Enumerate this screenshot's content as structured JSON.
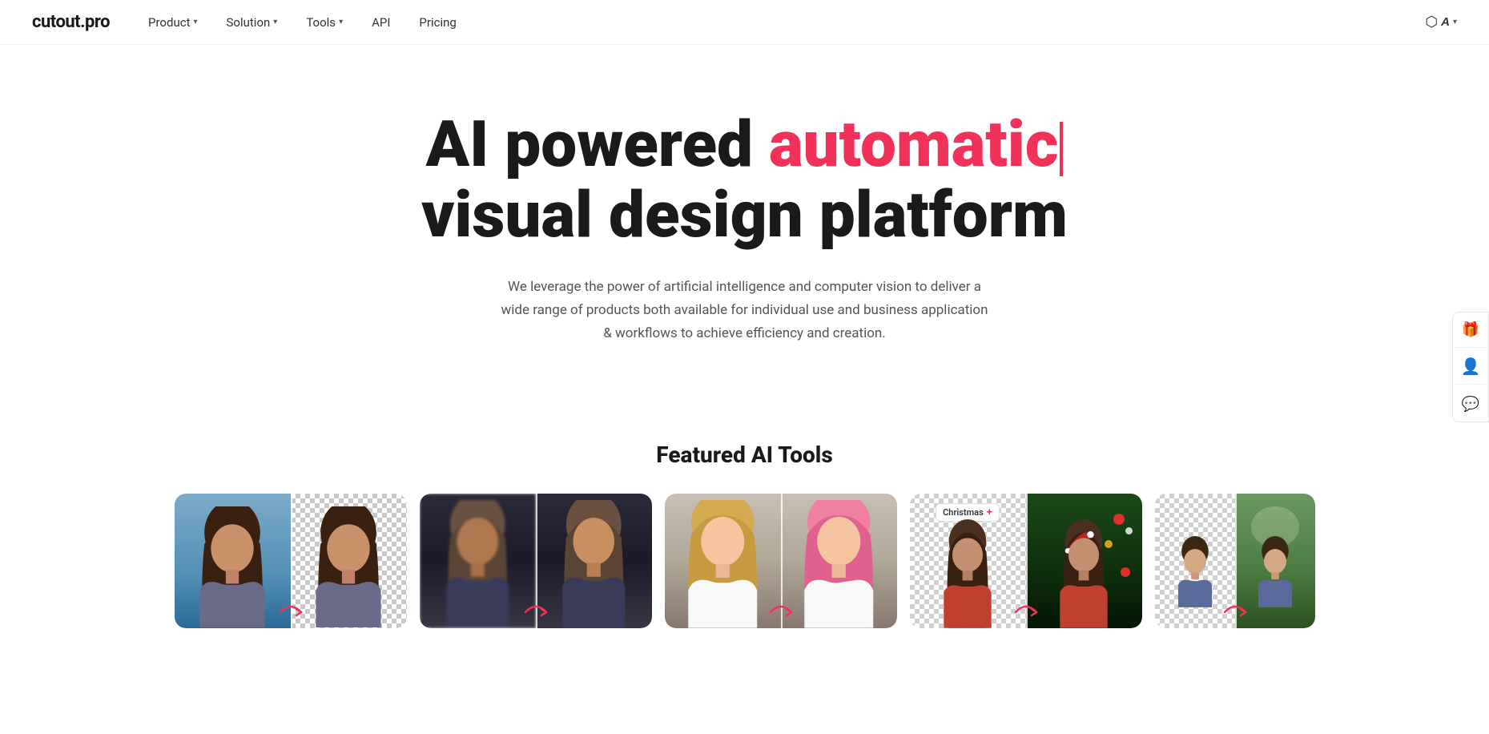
{
  "site": {
    "logo": "cutout.pro",
    "logo_dot_color": "#f0315a"
  },
  "nav": {
    "items": [
      {
        "label": "Product",
        "has_dropdown": true
      },
      {
        "label": "Solution",
        "has_dropdown": true
      },
      {
        "label": "Tools",
        "has_dropdown": true
      },
      {
        "label": "API",
        "has_dropdown": false
      },
      {
        "label": "Pricing",
        "has_dropdown": false
      }
    ],
    "lang_label": "A",
    "lang_icon": "🌐"
  },
  "hero": {
    "title_part1": "AI powered ",
    "title_highlight": "automatic",
    "title_part2": "visual design platform",
    "subtitle": "We leverage the power of artificial intelligence and computer vision to deliver a wide range of products both available for individual use and business application & workflows to achieve efficiency and creation."
  },
  "featured": {
    "title": "Featured AI Tools",
    "cards": [
      {
        "id": "card1",
        "type": "portrait-removal"
      },
      {
        "id": "card2",
        "type": "portrait-blur"
      },
      {
        "id": "card3",
        "type": "portrait-hair"
      },
      {
        "id": "card4",
        "type": "christmas"
      },
      {
        "id": "card5",
        "type": "portrait-child"
      }
    ]
  },
  "sidebar": {
    "buttons": [
      {
        "icon": "🎁",
        "label": "gift"
      },
      {
        "icon": "👤",
        "label": "user"
      },
      {
        "icon": "💬",
        "label": "chat"
      }
    ]
  }
}
